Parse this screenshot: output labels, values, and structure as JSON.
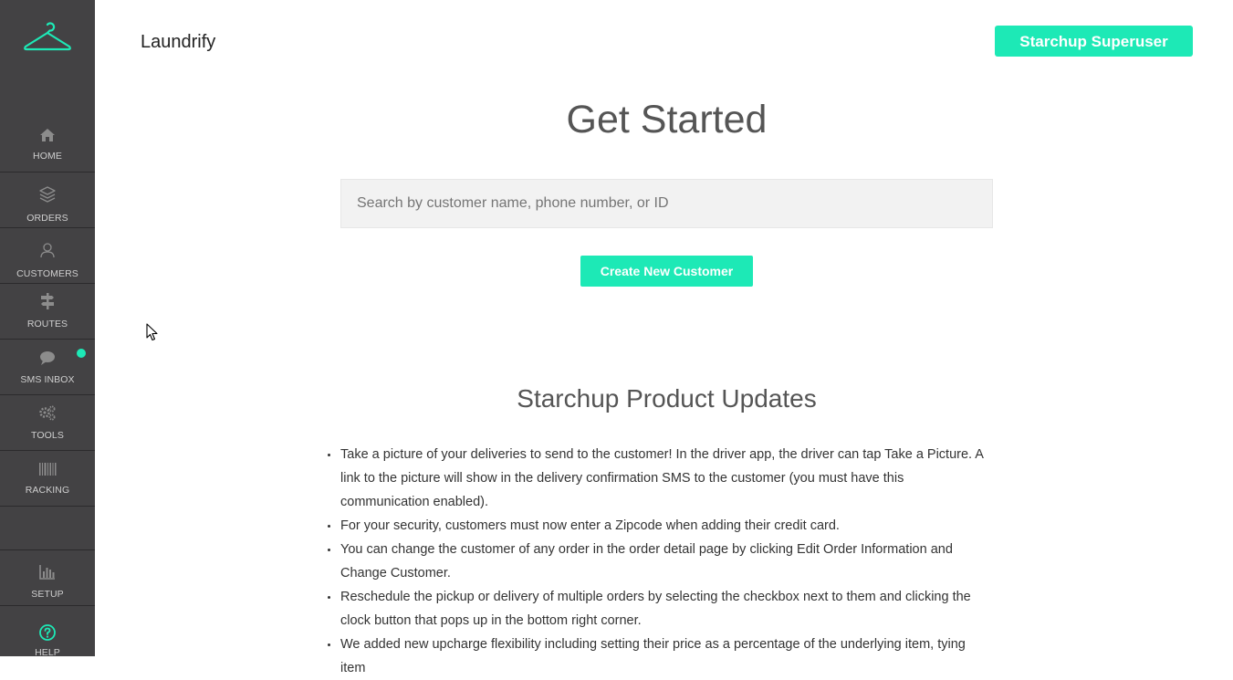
{
  "sidebar": {
    "items": [
      {
        "label": "HOME",
        "icon": "home-icon"
      },
      {
        "label": "ORDERS",
        "icon": "layers-icon"
      },
      {
        "label": "CUSTOMERS",
        "icon": "user-icon"
      },
      {
        "label": "ROUTES",
        "icon": "signpost-icon"
      },
      {
        "label": "SMS INBOX",
        "icon": "chat-bubble-icon",
        "has_notification": true
      },
      {
        "label": "TOOLS",
        "icon": "gears-icon"
      },
      {
        "label": "RACKING",
        "icon": "barcode-icon"
      },
      {
        "label": "SETUP",
        "icon": "bar-chart-icon"
      },
      {
        "label": "HELP",
        "icon": "question-circle-icon"
      }
    ]
  },
  "header": {
    "brand": "Laundrify",
    "user_button": "Starchup Superuser"
  },
  "main": {
    "title": "Get Started",
    "search_placeholder": "Search by customer name, phone number, or ID",
    "create_button": "Create New Customer",
    "updates_title": "Starchup Product Updates",
    "updates": [
      "Take a picture of your deliveries to send to the customer! In the driver app, the driver can tap Take a Picture. A link to the picture will show in the delivery confirmation SMS to the customer (you must have this communication enabled).",
      "For your security, customers must now enter a Zipcode when adding their credit card.",
      "You can change the customer of any order in the order detail page by clicking Edit Order Information and Change Customer.",
      "Reschedule the pickup or delivery of multiple orders by selecting the checkbox next to them and clicking the clock button that pops up in the bottom right corner.",
      "We added new upcharge flexibility including setting their price as a percentage of the underlying item, tying item"
    ]
  },
  "colors": {
    "accent": "#1de9b6",
    "sidebar_bg": "#434244",
    "sidebar_icon": "#9a9a9a"
  }
}
